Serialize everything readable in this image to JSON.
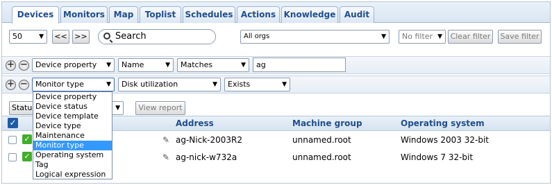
{
  "tabs": [
    {
      "label": "Devices",
      "active": true
    },
    {
      "label": "Monitors",
      "active": false
    },
    {
      "label": "Map",
      "active": false
    },
    {
      "label": "Toplist",
      "active": false
    },
    {
      "label": "Schedules",
      "active": false
    },
    {
      "label": "Actions",
      "active": false
    },
    {
      "label": "Knowledge",
      "active": false
    },
    {
      "label": "Audit",
      "active": false
    }
  ],
  "toolbar": {
    "page_size": "50",
    "prev_label": "<<",
    "next_label": ">>",
    "search_placeholder": "Search",
    "orgs": "All orgs",
    "filter_select": "No filter",
    "clear_filter": "Clear filter",
    "save_filter": "Save filter"
  },
  "filter1": {
    "property": "Device property",
    "field": "Name",
    "operator": "Matches",
    "value": "ag"
  },
  "filter2": {
    "property": "Monitor type",
    "field": "Disk utilization",
    "operator": "Exists"
  },
  "actionbar": {
    "status_button": "Status",
    "view_report": "View report"
  },
  "table": {
    "headers": [
      "Address",
      "Machine group",
      "Operating system"
    ],
    "rows": [
      {
        "address": "ag-Nick-2003R2",
        "group": "unnamed.root",
        "os": "Windows 2003 32-bit"
      },
      {
        "address": "ag-nick-w732a",
        "group": "unnamed.root",
        "os": "Windows 7 32-bit"
      }
    ]
  },
  "dropdown": {
    "items": [
      "Device property",
      "Device status",
      "Device template",
      "Device type",
      "Maintenance",
      "Monitor type",
      "Operating system",
      "Tag",
      "Logical expression"
    ],
    "selected": "Monitor type"
  },
  "colors": {
    "accent": "#1f4e8c",
    "selection": "#3399ff",
    "ok": "#3fae29"
  }
}
